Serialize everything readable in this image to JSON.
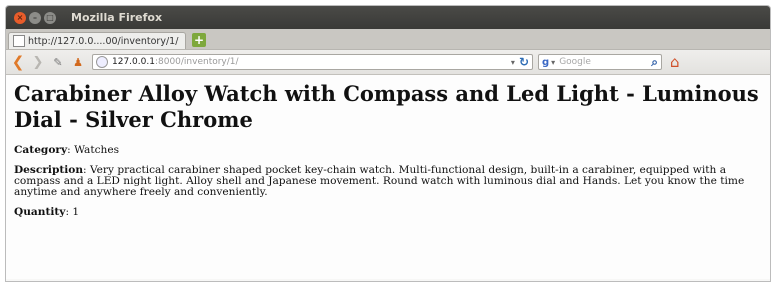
{
  "window": {
    "title": "Mozilla Firefox"
  },
  "tab": {
    "label": "http://127.0.0....00/inventory/1/"
  },
  "urlbar": {
    "host": "127.0.0.1",
    "path": ":8000/inventory/1/"
  },
  "searchbar": {
    "placeholder": "Google"
  },
  "page": {
    "heading": "Carabiner Alloy Watch with Compass and Led Light - Luminous Dial - Silver Chrome",
    "category_label": "Category",
    "category_value": ": Watches",
    "description_label": "Description",
    "description_value": ": Very practical carabiner shaped pocket key-chain watch. Multi-functional design, built-in a carabiner, equipped with a compass and a LED night light. Alloy shell and Japanese movement. Round watch with luminous dial and Hands. Let you know the time anytime and anywhere freely and conveniently.",
    "quantity_label": "Quantity",
    "quantity_value": ": 1"
  },
  "icons": {
    "close": "close-icon",
    "minimize": "minimize-icon",
    "maximize": "maximize-icon",
    "back": "back-arrow-icon",
    "forward": "forward-arrow-icon",
    "reload": "reload-icon",
    "search": "search-icon",
    "home": "home-icon"
  },
  "colors": {
    "close_button": "#e85c2a",
    "titlebar": "#3a3a37",
    "new_tab": "#7ea83c"
  }
}
